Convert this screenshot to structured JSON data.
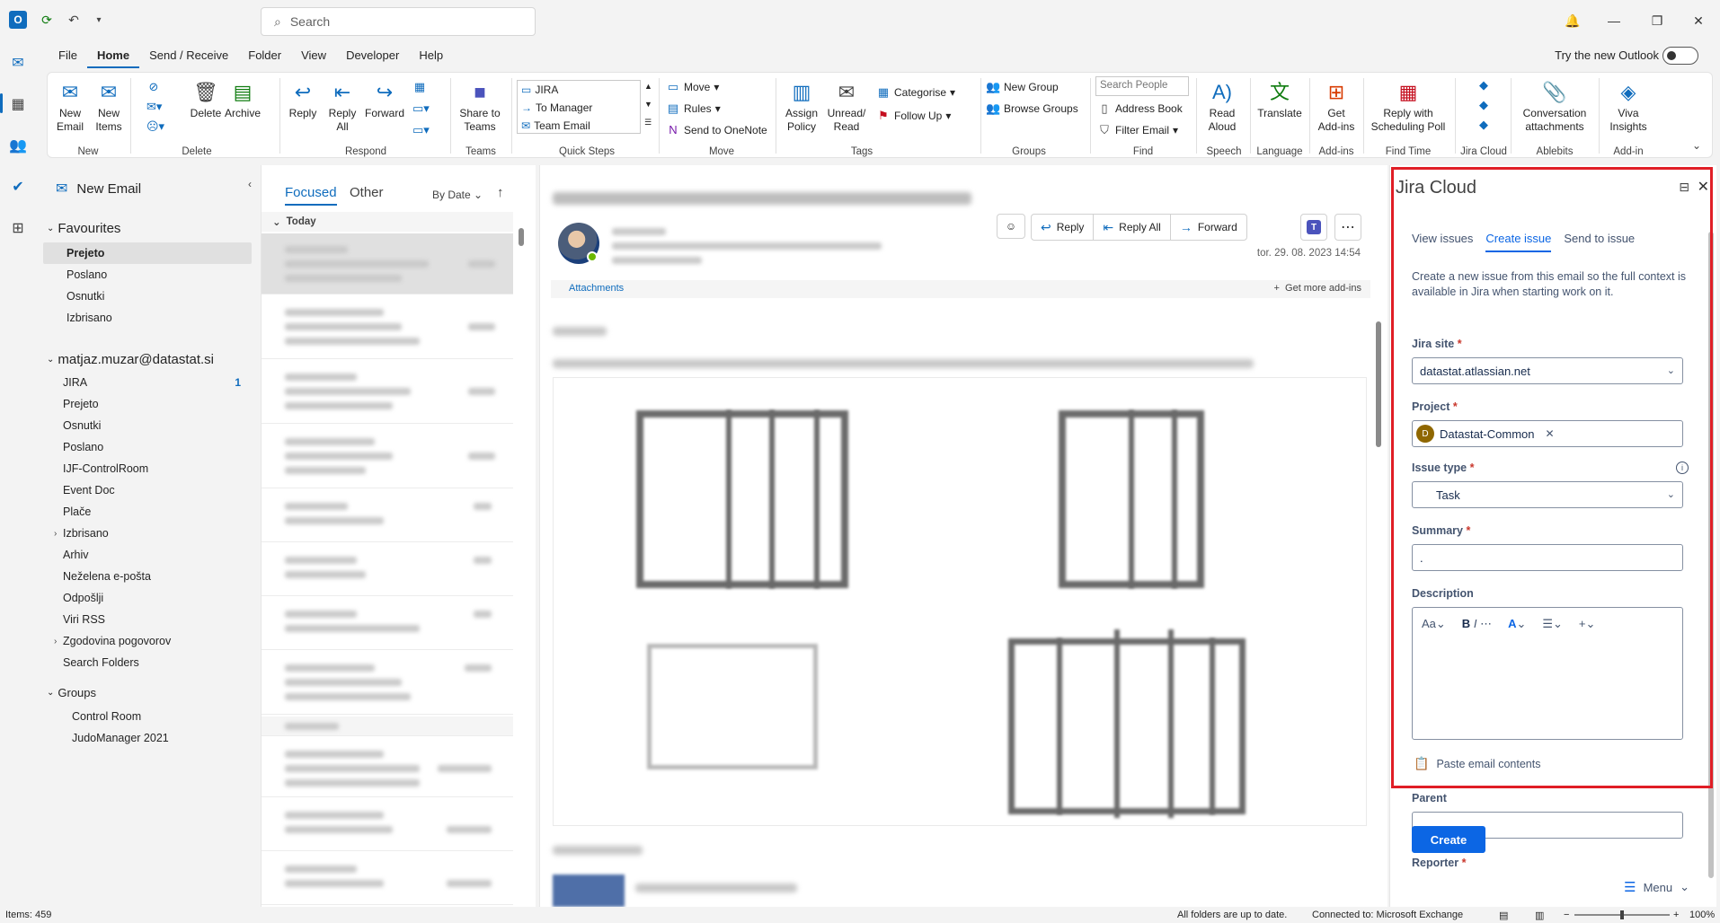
{
  "titlebar": {
    "search_placeholder": "Search"
  },
  "menu": {
    "tabs": [
      "File",
      "Home",
      "Send / Receive",
      "Folder",
      "View",
      "Developer",
      "Help"
    ],
    "try_new": "Try the new Outlook"
  },
  "ribbon": {
    "new_email": "New\nEmail",
    "new_items": "New\nItems",
    "delete": "Delete",
    "archive": "Archive",
    "reply": "Reply",
    "reply_all": "Reply\nAll",
    "forward": "Forward",
    "share_teams": "Share to\nTeams",
    "qs_jira": "JIRA",
    "qs_manager": "To Manager",
    "qs_team": "Team Email",
    "move": "Move",
    "rules": "Rules",
    "onenote": "Send to OneNote",
    "assign_policy": "Assign\nPolicy",
    "unread_read": "Unread/\nRead",
    "categorise": "Categorise",
    "follow_up": "Follow Up",
    "new_group": "New Group",
    "browse_groups": "Browse Groups",
    "search_people": "Search People",
    "address_book": "Address Book",
    "filter_email": "Filter Email",
    "read_aloud": "Read\nAloud",
    "translate": "Translate",
    "get_addins": "Get\nAdd-ins",
    "reply_poll": "Reply with\nScheduling Poll",
    "conversation_attachments": "Conversation\nattachments",
    "viva": "Viva\nInsights",
    "groups": {
      "new": "New",
      "delete": "Delete",
      "respond": "Respond",
      "teams": "Teams",
      "quick_steps": "Quick Steps",
      "move": "Move",
      "tags": "Tags",
      "groups": "Groups",
      "find": "Find",
      "speech": "Speech",
      "language": "Language",
      "addins": "Add-ins",
      "find_time": "Find Time",
      "jira_cloud": "Jira Cloud",
      "ablebits": "Ablebits",
      "addin": "Add-in"
    }
  },
  "folders": {
    "new_email": "New Email",
    "favourites_label": "Favourites",
    "favourites": [
      "Prejeto",
      "Poslano",
      "Osnutki",
      "Izbrisano"
    ],
    "account": "matjaz.muzar@datastat.si",
    "account_folders": [
      {
        "name": "JIRA",
        "count": "1"
      },
      {
        "name": "Prejeto",
        "count": ""
      },
      {
        "name": "Osnutki",
        "count": ""
      },
      {
        "name": "Poslano",
        "count": ""
      },
      {
        "name": "IJF-ControlRoom",
        "count": ""
      },
      {
        "name": "Event Doc",
        "count": ""
      },
      {
        "name": "Plače",
        "count": ""
      },
      {
        "name": "Izbrisano",
        "count": ""
      },
      {
        "name": "Arhiv",
        "count": ""
      },
      {
        "name": "Neželena e-pošta",
        "count": ""
      },
      {
        "name": "Odpošlji",
        "count": ""
      },
      {
        "name": "Viri RSS",
        "count": ""
      },
      {
        "name": "Zgodovina pogovorov",
        "count": ""
      },
      {
        "name": "Search Folders",
        "count": ""
      }
    ],
    "groups_label": "Groups",
    "groups": [
      "Control Room",
      "JudoManager 2021"
    ]
  },
  "messagelist": {
    "tab_focused": "Focused",
    "tab_other": "Other",
    "sort": "By Date",
    "today": "Today"
  },
  "reading": {
    "reply": "Reply",
    "reply_all": "Reply All",
    "forward": "Forward",
    "date": "tor. 29. 08. 2023 14:54",
    "attachments": "Attachments",
    "get_addins": "Get more add-ins"
  },
  "jira": {
    "title": "Jira Cloud",
    "tabs": [
      "View issues",
      "Create issue",
      "Send to issue"
    ],
    "active_tab": "Create issue",
    "description": "Create a new issue from this email so the full context is available in Jira when starting work on it.",
    "site_label": "Jira site",
    "site_value": "datastat.atlassian.net",
    "project_label": "Project",
    "project_value": "Datastat-Common",
    "project_avatar": "D",
    "issue_type_label": "Issue type",
    "issue_type_value": "Task",
    "summary_label": "Summary",
    "summary_value": ".",
    "description_label": "Description",
    "paste": "Paste email contents",
    "parent_label": "Parent",
    "create": "Create",
    "reporter_label": "Reporter",
    "menu": "Menu",
    "accent": "#0c66e4",
    "highlight_color": "#e01e26"
  },
  "status": {
    "items": "Items: 459",
    "sync": "All folders are up to date.",
    "connection": "Connected to: Microsoft Exchange",
    "zoom": "100%"
  }
}
